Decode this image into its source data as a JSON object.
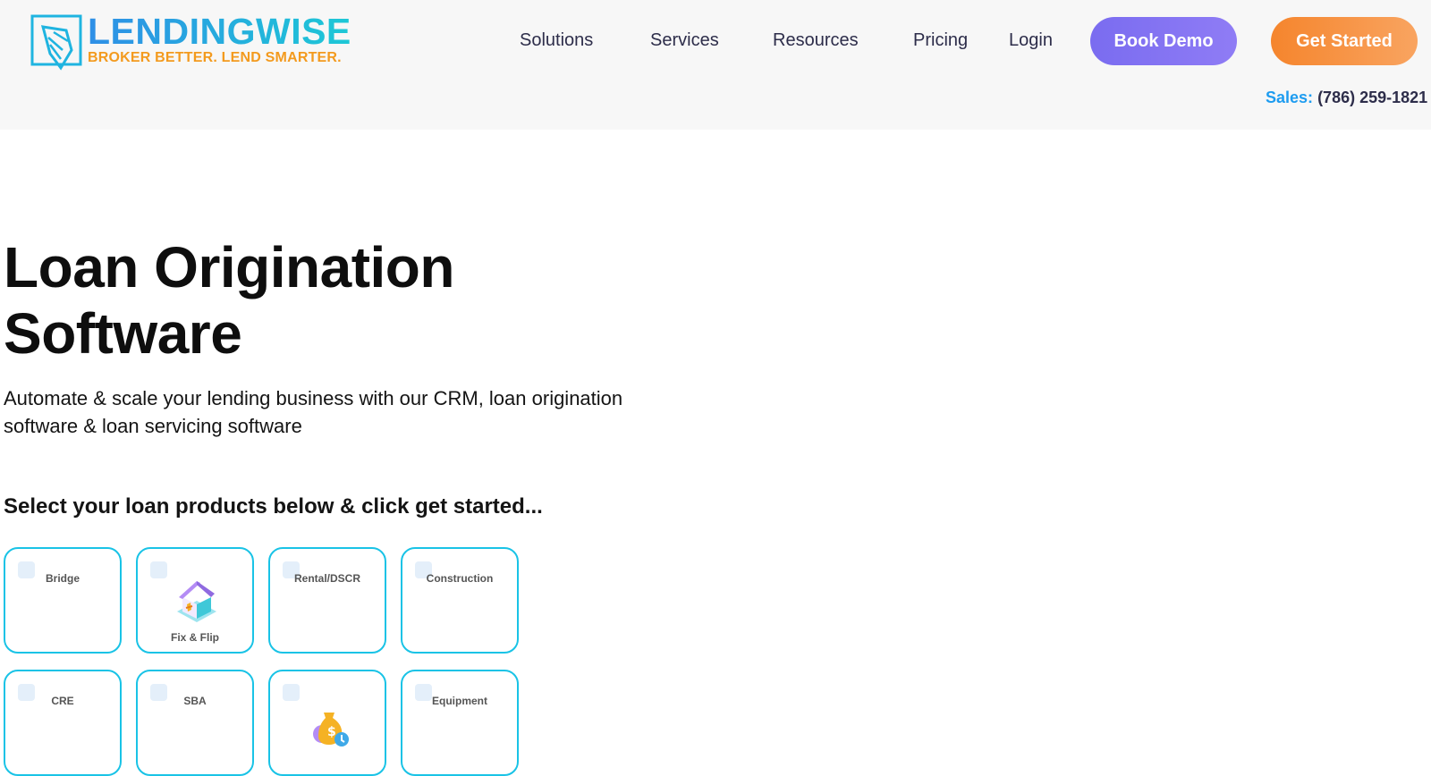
{
  "header": {
    "logo_text": "LENDINGWISE",
    "logo_tagline": "BROKER BETTER. LEND SMARTER.",
    "nav": [
      {
        "label": "Solutions"
      },
      {
        "label": "Services"
      },
      {
        "label": "Resources"
      },
      {
        "label": "Pricing"
      },
      {
        "label": "Login"
      }
    ],
    "book_demo_label": "Book Demo",
    "get_started_label": "Get Started",
    "sales_label": "Sales:",
    "sales_phone": "(786) 259-1821"
  },
  "hero": {
    "title_line1": "Loan Origination",
    "title_line2": "Software",
    "subtitle": "Automate & scale your lending business with our CRM, loan origination software & loan servicing software",
    "prompt": "Select your loan products below & click get started..."
  },
  "loan_products": [
    {
      "label": "Bridge",
      "icon": "",
      "checked": false
    },
    {
      "label": "Fix & Flip",
      "icon": "house-icon",
      "checked": false
    },
    {
      "label": "Rental/DSCR",
      "icon": "",
      "checked": false
    },
    {
      "label": "Construction",
      "icon": "",
      "checked": false
    },
    {
      "label": "CRE",
      "icon": "",
      "checked": false
    },
    {
      "label": "SBA",
      "icon": "",
      "checked": false
    },
    {
      "label": "",
      "icon": "money-bag-icon",
      "checked": false
    },
    {
      "label": "Equipment",
      "icon": "",
      "checked": false
    }
  ],
  "colors": {
    "brand_blue": "#1dc8d6",
    "brand_orange": "#f39a1e",
    "demo_purple": "#7a6cf0",
    "start_orange": "#f5852d",
    "card_border": "#19c3e6"
  }
}
